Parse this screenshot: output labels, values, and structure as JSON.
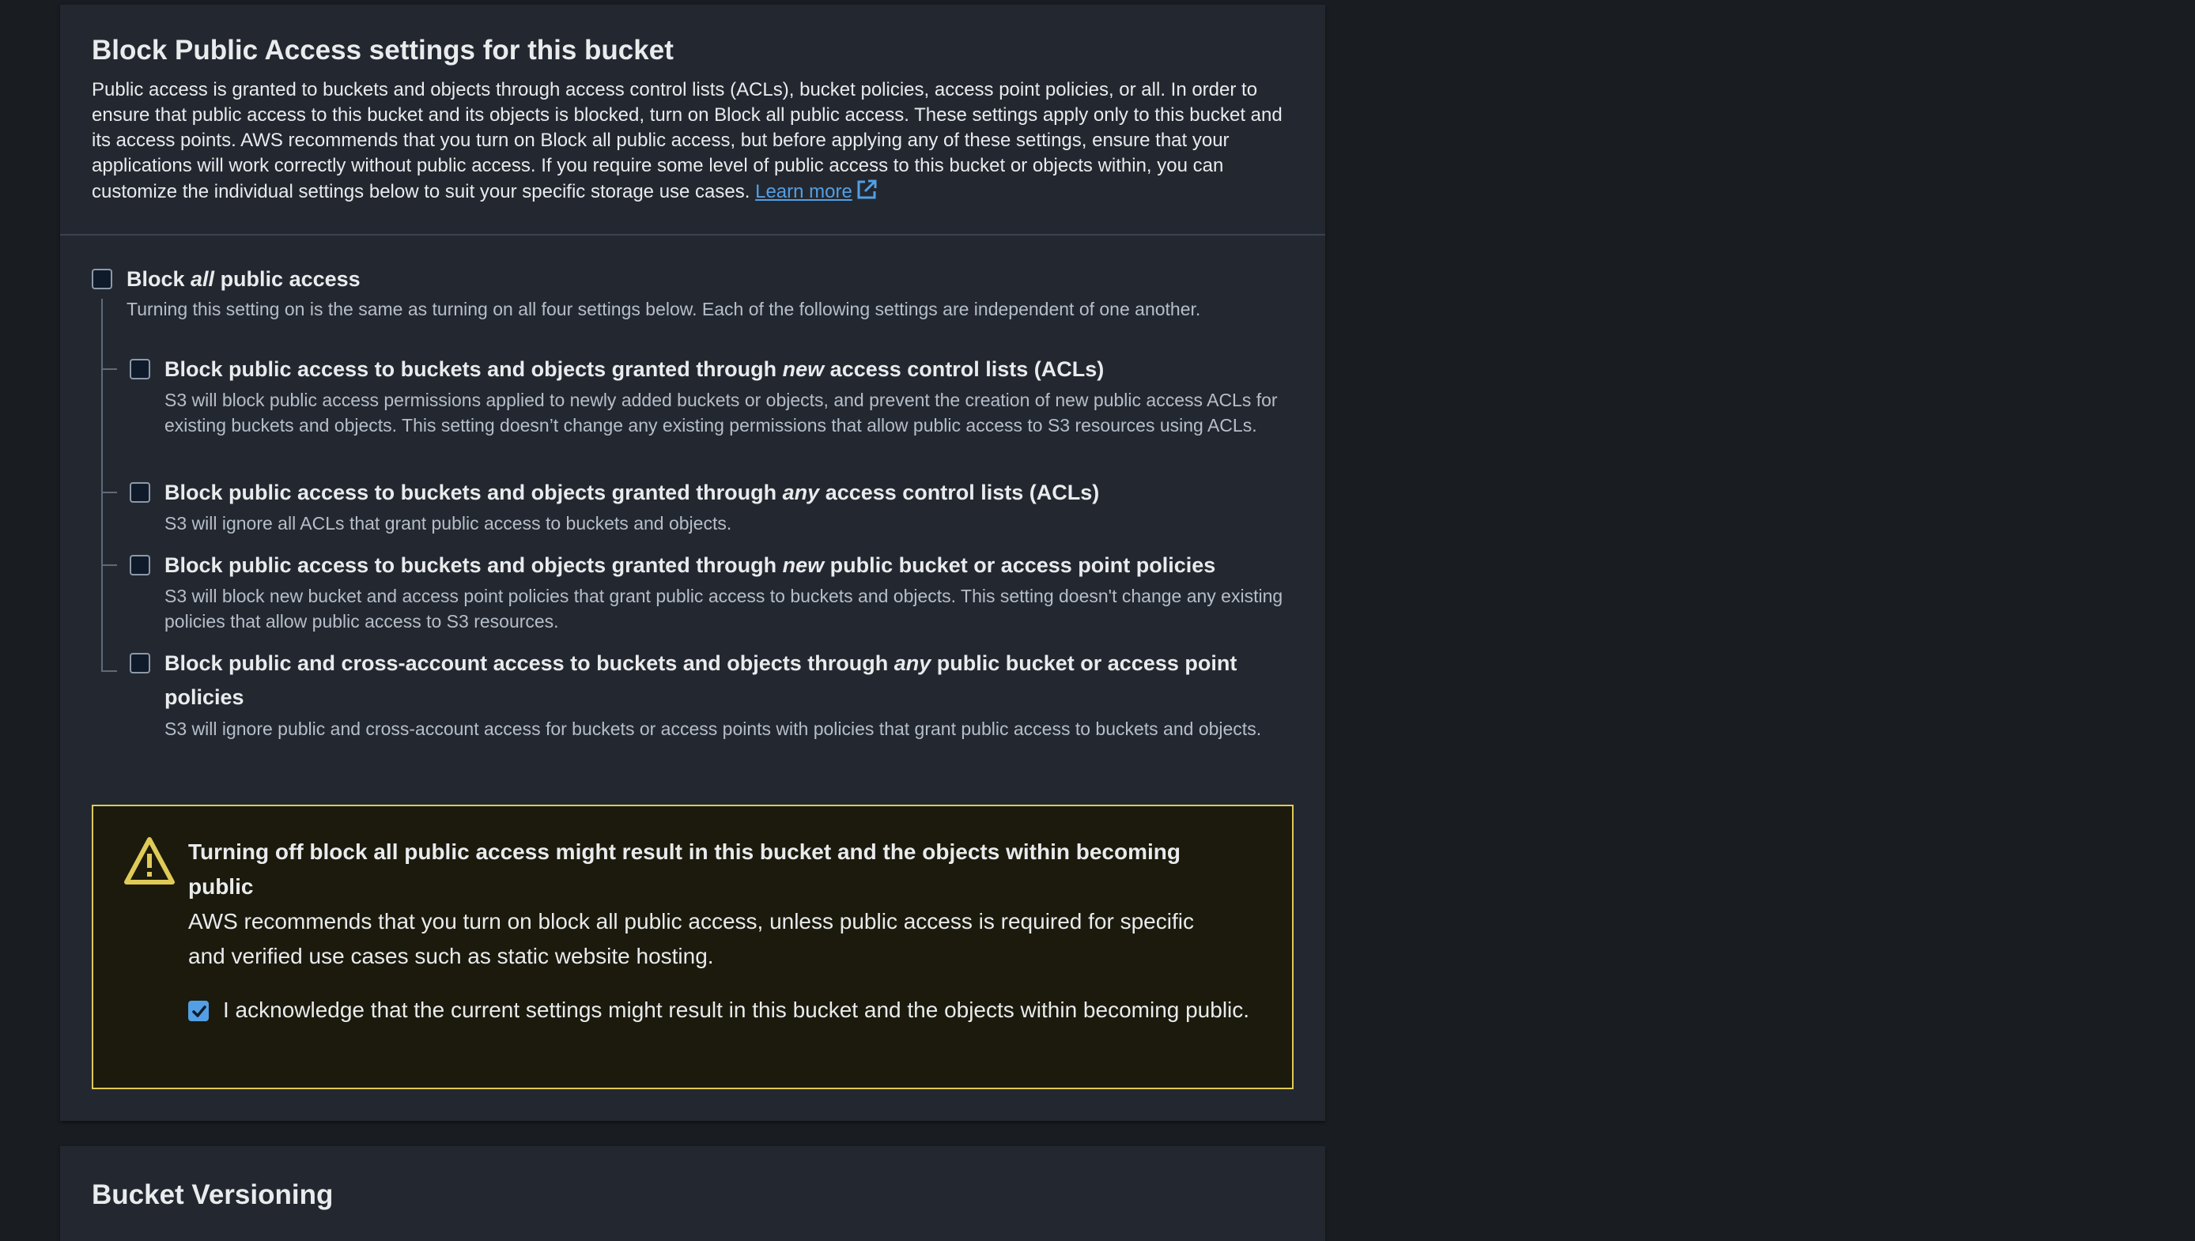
{
  "block_public_access": {
    "title": "Block Public Access settings for this bucket",
    "description": "Public access is granted to buckets and objects through access control lists (ACLs), bucket policies, access point policies, or all. In order to ensure that public access to this bucket and its objects is blocked, turn on Block all public access. These settings apply only to this bucket and its access points. AWS recommends that you turn on Block all public access, but before applying any of these settings, ensure that your applications will work correctly without public access. If you require some level of public access to this bucket or objects within, you can customize the individual settings below to suit your specific storage use cases.",
    "learn_more": "Learn more",
    "block_all": {
      "label_pre": "Block ",
      "label_em": "all",
      "label_post": " public access",
      "description": "Turning this setting on is the same as turning on all four settings below. Each of the following settings are independent of one another.",
      "checked": false
    },
    "options": [
      {
        "label_pre": "Block public access to buckets and objects granted through ",
        "label_em": "new",
        "label_post": " access control lists (ACLs)",
        "description": "S3 will block public access permissions applied to newly added buckets or objects, and prevent the creation of new public access ACLs for existing buckets and objects. This setting doesn’t change any existing permissions that allow public access to S3 resources using ACLs.",
        "checked": false
      },
      {
        "label_pre": "Block public access to buckets and objects granted through ",
        "label_em": "any",
        "label_post": " access control lists (ACLs)",
        "description": "S3 will ignore all ACLs that grant public access to buckets and objects.",
        "checked": false
      },
      {
        "label_pre": "Block public access to buckets and objects granted through ",
        "label_em": "new",
        "label_post": " public bucket or access point policies",
        "description": "S3 will block new bucket and access point policies that grant public access to buckets and objects. This setting doesn't change any existing policies that allow public access to S3 resources.",
        "checked": false
      },
      {
        "label_pre": "Block public and cross-account access to buckets and objects through ",
        "label_em": "any",
        "label_post": " public bucket or access point",
        "label_line2": "policies",
        "description": "S3 will ignore public and cross-account access for buckets or access points with policies that grant public access to buckets and objects.",
        "checked": false
      }
    ]
  },
  "warning": {
    "title": "Turning off block all public access might result in this bucket and the objects within becoming public",
    "body": "AWS recommends that you turn on block all public access, unless public access is required for specific and verified use cases such as static website hosting.",
    "acknowledge_label": "I acknowledge that the current settings might result in this bucket and the objects within becoming public.",
    "acknowledged": true,
    "icon": "warning-icon"
  },
  "next_section": {
    "title": "Bucket Versioning"
  },
  "colors": {
    "page_background": "#191c21",
    "panel_background": "#232830",
    "link": "#539fe5",
    "warning_border": "#e0ca57",
    "warning_background": "#1b1a0c",
    "checkbox_checked": "#539fe5"
  }
}
